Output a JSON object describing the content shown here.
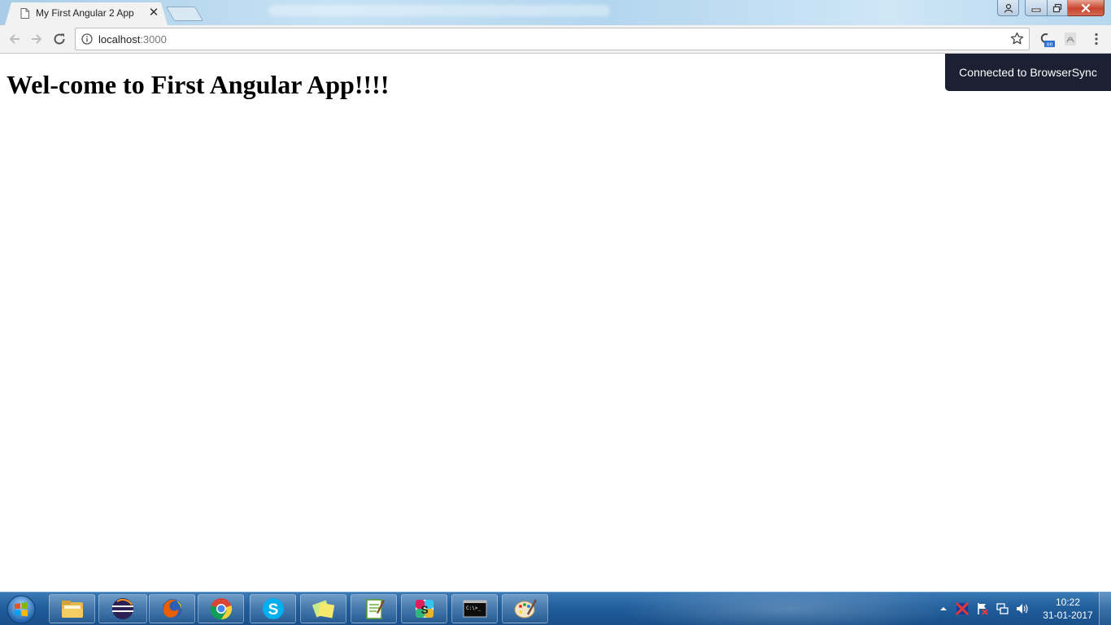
{
  "browser": {
    "tab": {
      "title": "My First Angular 2 App",
      "close_glyph": "✕"
    },
    "omnibox": {
      "host": "localhost",
      "port": ":3000"
    },
    "extensions": {
      "toggle_badge": "on"
    }
  },
  "page": {
    "heading": "Wel-come to First Angular App!!!!",
    "notification": "Connected to BrowserSync"
  },
  "taskbar": {
    "apps": [
      {
        "name": "file-explorer-icon"
      },
      {
        "name": "eclipse-icon"
      },
      {
        "name": "firefox-icon"
      },
      {
        "name": "chrome-icon"
      },
      {
        "name": "skype-icon"
      },
      {
        "name": "sticky-notes-icon"
      },
      {
        "name": "notepad-plus-plus-icon"
      },
      {
        "name": "slack-icon"
      },
      {
        "name": "command-prompt-icon"
      },
      {
        "name": "paint-icon"
      }
    ],
    "cmd_label": "C:\\>_",
    "clock": {
      "time": "10:22",
      "date": "31-01-2017"
    }
  },
  "colors": {
    "notification_bg": "#1b2032",
    "taskbar": "#215e9c",
    "close_button": "#c7442d"
  }
}
